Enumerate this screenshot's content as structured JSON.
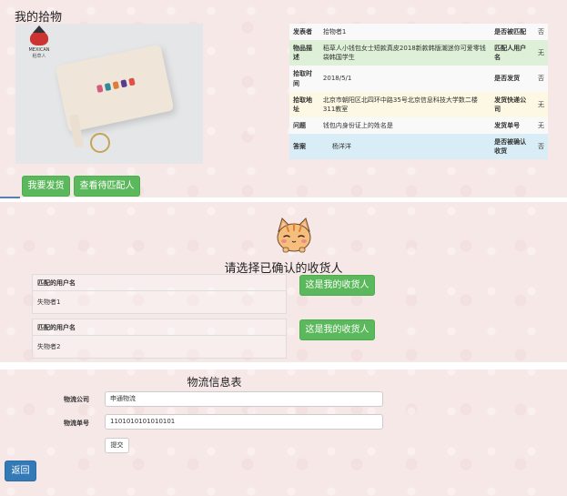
{
  "page": {
    "title": "我的拾物"
  },
  "product_image": {
    "brand": "MEXICAN",
    "brand_cn": "稻草人"
  },
  "info_table": {
    "rows": [
      {
        "k": "发表者",
        "v": "拾物者1",
        "k2": "是否被匹配",
        "v2": "否"
      },
      {
        "k": "物品描述",
        "v": "稻草人小钱包女士短款真皮2018新款韩版潮迷你可爱零钱袋韩国学生",
        "k2": "匹配人用户名",
        "v2": "无"
      },
      {
        "k": "拾取时间",
        "v": "2018/5/1",
        "k2": "是否发货",
        "v2": "否"
      },
      {
        "k": "拾取地址",
        "v": "北京市朝阳区北四环中路35号北京信息科技大学数二楼311教室",
        "k2": "发货快递公司",
        "v2": "无"
      },
      {
        "k": "问题",
        "v": "钱包内身份证上的姓名是",
        "k2": "发货单号",
        "v2": "无"
      },
      {
        "k": "答案",
        "v": "杨洋洋",
        "k2": "是否被确认收货",
        "v2": "否"
      }
    ]
  },
  "actions": {
    "ship": "我要发货",
    "view_matches": "查看待匹配人"
  },
  "pick": {
    "title": "请选择已确认的收货人",
    "matches": [
      {
        "header": "匹配的用户名",
        "name": "失物者1",
        "button": "这是我的收货人"
      },
      {
        "header": "匹配的用户名",
        "name": "失物者2",
        "button": "这是我的收货人"
      }
    ]
  },
  "logistics": {
    "title": "物流信息表",
    "company_label": "物流公司",
    "company_value": "申通物流",
    "number_label": "物流单号",
    "number_value": "1101010101010101",
    "submit": "提交"
  },
  "back": "返回",
  "colors": {
    "background": "#f7e8e8",
    "green_button": "#5cb85c",
    "blue_button": "#337ab7",
    "row_green": "#dff0d8",
    "row_yellow": "#fcf8e3",
    "row_blue": "#d9edf7"
  },
  "icons": {
    "cat": "cat-face-icon",
    "brand_logo": "brand-logo-icon"
  }
}
